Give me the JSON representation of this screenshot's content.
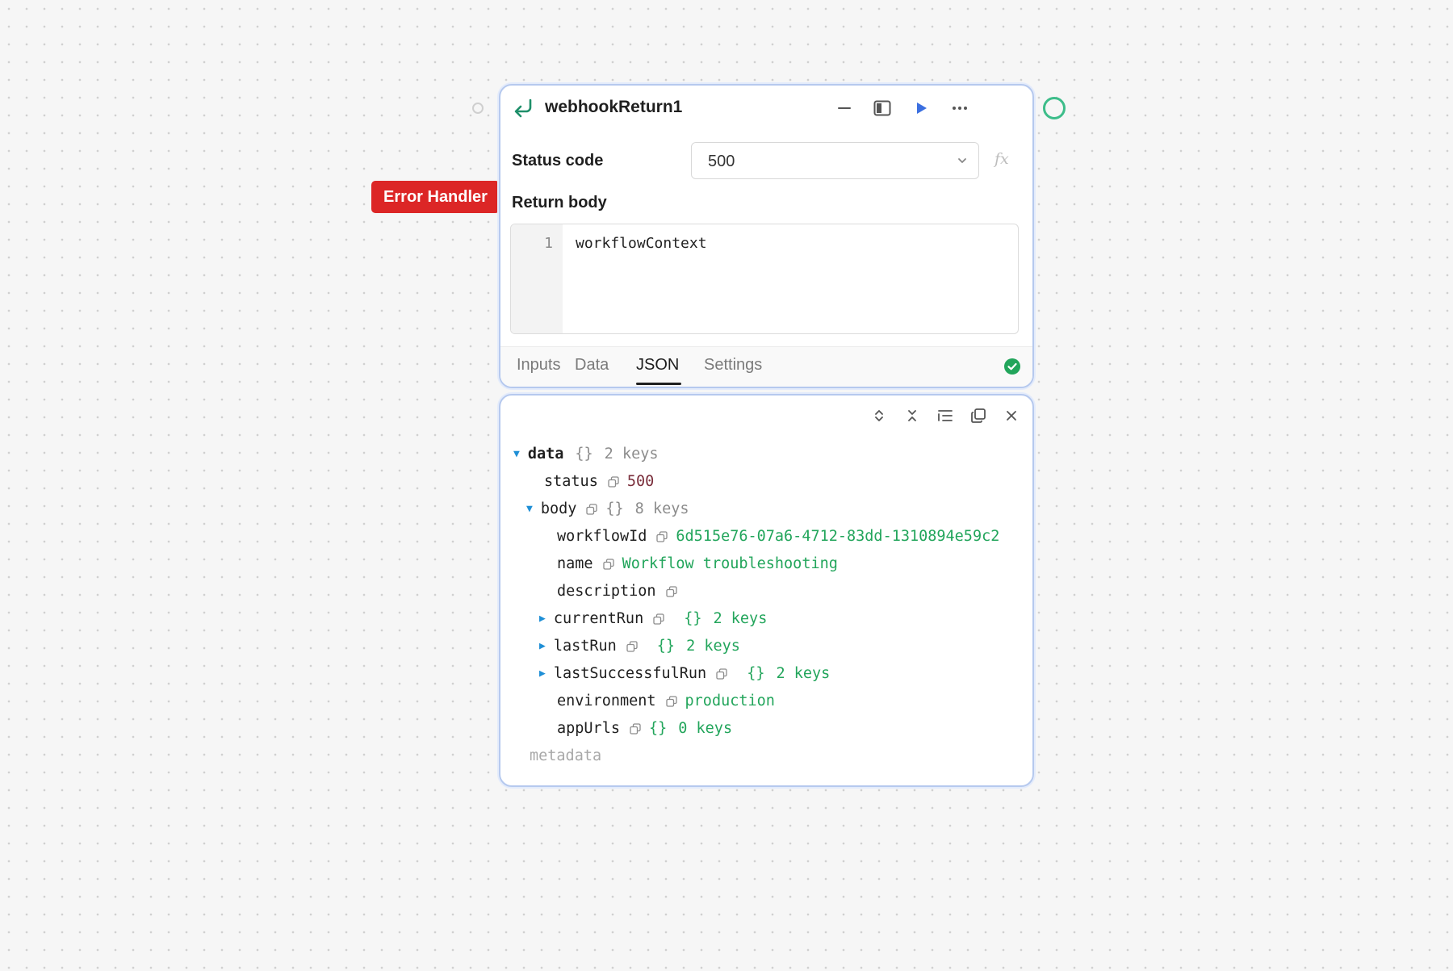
{
  "node": {
    "title": "webhookReturn1",
    "error_badge": "Error Handler",
    "status_code": {
      "label": "Status code",
      "value": "500",
      "fx_label": "fx"
    },
    "return_body": {
      "label": "Return body",
      "line_number": "1",
      "code": "workflowContext"
    },
    "tabs": [
      {
        "label": "Inputs",
        "active": false
      },
      {
        "label": "Data",
        "active": false
      },
      {
        "label": "JSON",
        "active": true
      },
      {
        "label": "Settings",
        "active": false
      }
    ],
    "status_color": "#22a55b"
  },
  "json_panel": {
    "root": {
      "key": "data",
      "braces": "{}",
      "count": "2 keys"
    },
    "status": {
      "key": "status",
      "value": "500"
    },
    "body": {
      "key": "body",
      "braces": "{}",
      "count": "8 keys"
    },
    "fields": {
      "workflowId": {
        "key": "workflowId",
        "value": "6d515e76-07a6-4712-83dd-1310894e59c2"
      },
      "name": {
        "key": "name",
        "value": "Workflow troubleshooting"
      },
      "description": {
        "key": "description"
      },
      "currentRun": {
        "key": "currentRun",
        "braces": "{}",
        "count": "2 keys"
      },
      "lastRun": {
        "key": "lastRun",
        "braces": "{}",
        "count": "2 keys"
      },
      "lastSuccessfulRun": {
        "key": "lastSuccessfulRun",
        "braces": "{}",
        "count": "2 keys"
      },
      "environment": {
        "key": "environment",
        "value": "production"
      },
      "appUrls": {
        "key": "appUrls",
        "braces": "{}",
        "count": "0 keys"
      }
    },
    "metadata": "metadata"
  },
  "colors": {
    "accent": "#3b6fe0",
    "error": "#dc2626",
    "success": "#22a55b",
    "port_active": "#3dbd8a"
  }
}
